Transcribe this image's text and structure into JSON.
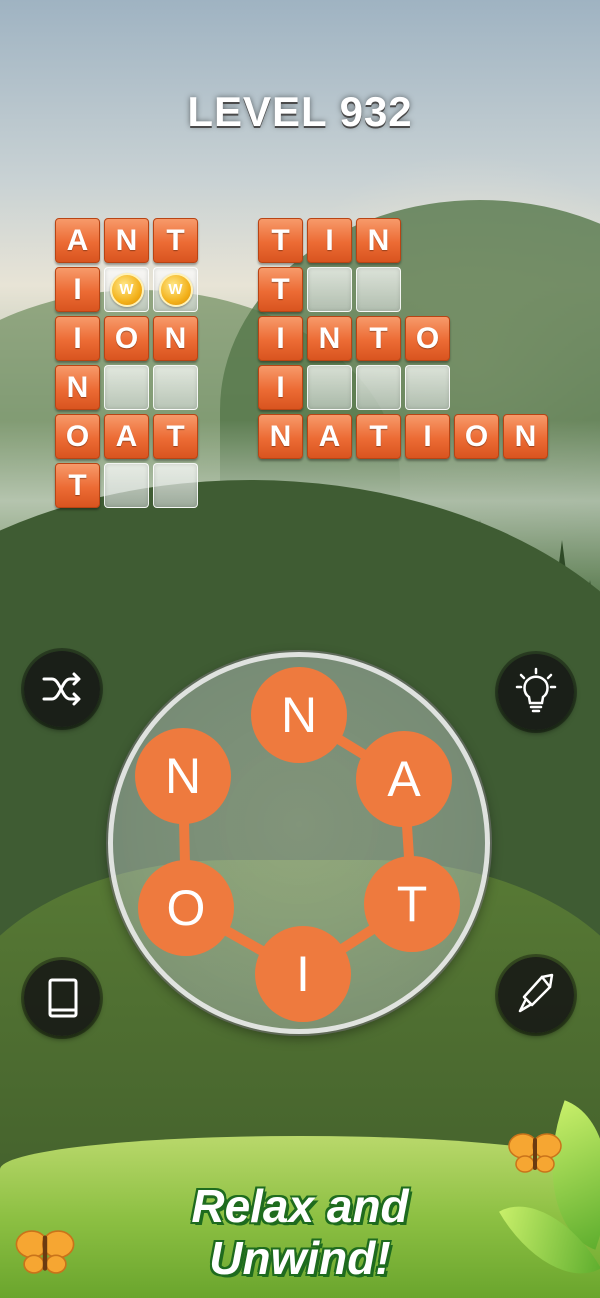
{
  "level": {
    "title": "LEVEL 932"
  },
  "grid": {
    "left": [
      {
        "cells": [
          "A",
          "N",
          "T"
        ]
      },
      {
        "cells": [
          "I",
          "coin",
          "coin"
        ]
      },
      {
        "cells": [
          "I",
          "O",
          "N"
        ]
      },
      {
        "cells": [
          "N",
          "",
          ""
        ]
      },
      {
        "cells": [
          "O",
          "A",
          "T"
        ]
      },
      {
        "cells": [
          "T",
          "",
          ""
        ]
      }
    ],
    "right": [
      {
        "cells": [
          "T",
          "I",
          "N"
        ]
      },
      {
        "cells": [
          "T",
          "",
          ""
        ]
      },
      {
        "cells": [
          "I",
          "N",
          "T",
          "O"
        ]
      },
      {
        "cells": [
          "I",
          "",
          "",
          ""
        ]
      },
      {
        "cells": [
          "N",
          "A",
          "T",
          "I",
          "O",
          "N"
        ]
      }
    ],
    "coin_symbol": "W"
  },
  "wheel": {
    "letters": [
      "N",
      "A",
      "T",
      "I",
      "O",
      "N"
    ]
  },
  "buttons": {
    "shuffle": "shuffle-icon",
    "hint": "lightbulb-icon",
    "dictionary": "book-icon",
    "rocket": "rocket-icon"
  },
  "banner": {
    "line1": "Relax and",
    "line2": "Unwind!"
  },
  "colors": {
    "tile": "#ec6b34",
    "letter_circle": "#ee7a3e",
    "banner_green": "#8dc043"
  }
}
